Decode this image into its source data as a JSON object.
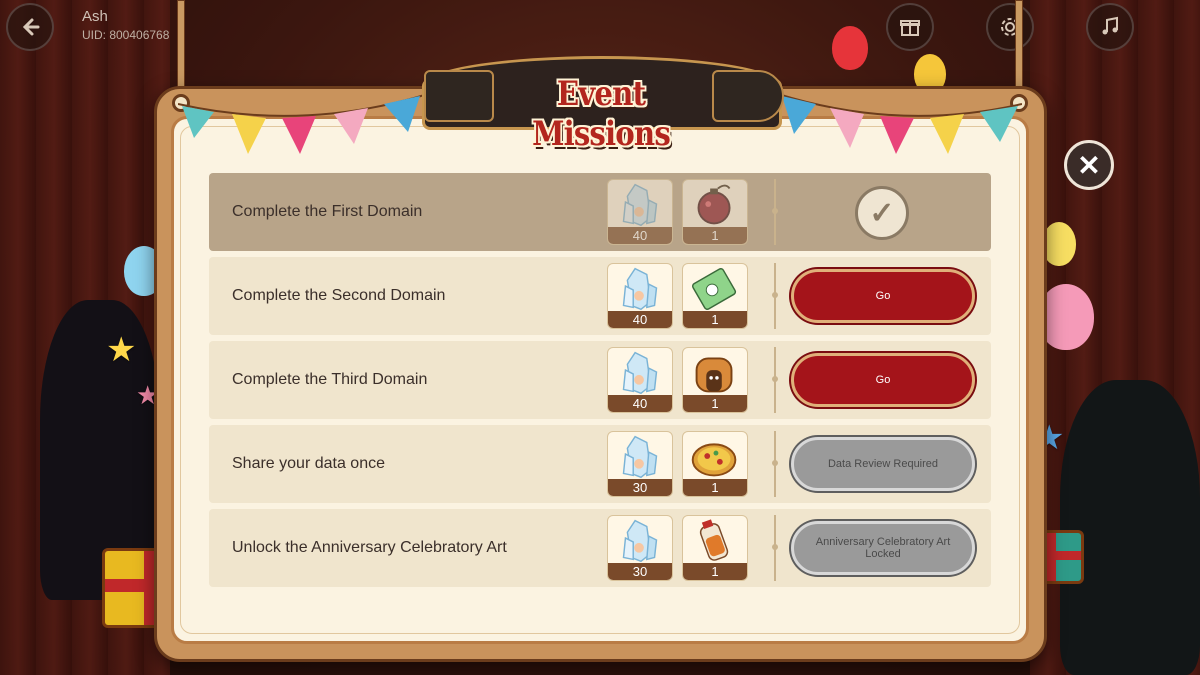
{
  "player": {
    "name": "Ash",
    "uid": "UID: 800406768"
  },
  "title": "Event Missions",
  "icons": {
    "back": "back-arrow-icon",
    "gift_menu": "gift-box-icon",
    "settings": "gear-icon",
    "music": "music-note-icon",
    "close": "close-icon",
    "completed": "checkmark-icon"
  },
  "colors": {
    "go_button": "#a4141a",
    "locked_button": "#9a9a9a",
    "title_text": "#b3261e",
    "panel_frame": "#c9935c",
    "panel_bg": "#fbf3e1"
  },
  "missions": [
    {
      "title": "Complete the First Domain",
      "status": "completed",
      "rewards": [
        {
          "icon": "crystal-icon",
          "count": "40"
        },
        {
          "icon": "pomegranate-bomb-icon",
          "count": "1"
        }
      ],
      "action_label": ""
    },
    {
      "title": "Complete the Second Domain",
      "status": "go",
      "rewards": [
        {
          "icon": "crystal-icon",
          "count": "40"
        },
        {
          "icon": "ticket-card-icon",
          "count": "1"
        }
      ],
      "action_label": "Go"
    },
    {
      "title": "Complete the Third Domain",
      "status": "go",
      "rewards": [
        {
          "icon": "crystal-icon",
          "count": "40"
        },
        {
          "icon": "bread-loaf-icon",
          "count": "1"
        }
      ],
      "action_label": "Go"
    },
    {
      "title": "Share your data once",
      "status": "locked",
      "rewards": [
        {
          "icon": "crystal-icon",
          "count": "30"
        },
        {
          "icon": "pizza-icon",
          "count": "1"
        }
      ],
      "action_label": "Data Review Required"
    },
    {
      "title": "Unlock the Anniversary Celebratory Art",
      "status": "locked",
      "rewards": [
        {
          "icon": "crystal-icon",
          "count": "30"
        },
        {
          "icon": "bottle-potion-icon",
          "count": "1"
        }
      ],
      "action_label": "Anniversary Celebratory Art Locked"
    }
  ]
}
